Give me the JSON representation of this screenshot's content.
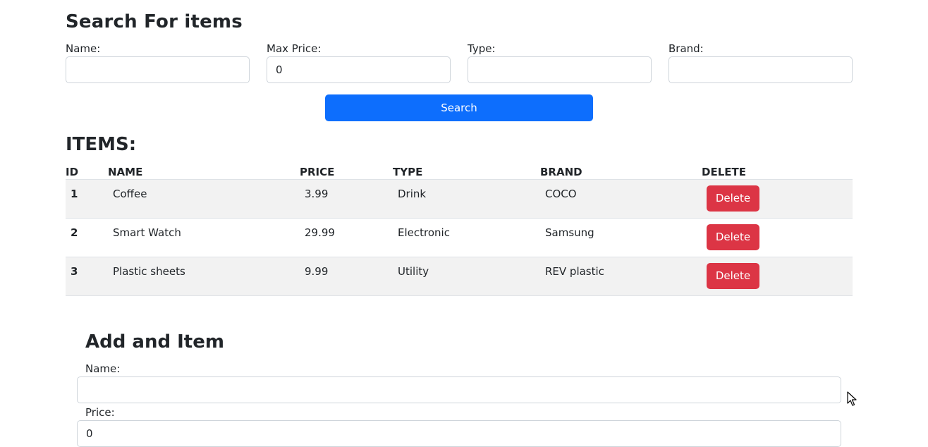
{
  "search": {
    "title": "Search For items",
    "fields": [
      {
        "label": "Name:",
        "value": "",
        "placeholder": ""
      },
      {
        "label": "Max Price:",
        "value": "0",
        "placeholder": ""
      },
      {
        "label": "Type:",
        "value": "",
        "placeholder": ""
      },
      {
        "label": "Brand:",
        "value": "",
        "placeholder": ""
      }
    ],
    "button_label": "Search"
  },
  "items": {
    "title": "ITEMS:",
    "columns": [
      "ID",
      "NAME",
      "PRICE",
      "TYPE",
      "BRAND",
      "DELETE"
    ],
    "rows": [
      {
        "id": "1",
        "name": "Coffee",
        "price": "3.99",
        "type": "Drink",
        "brand": "COCO",
        "action": "Delete"
      },
      {
        "id": "2",
        "name": "Smart Watch",
        "price": "29.99",
        "type": "Electronic",
        "brand": "Samsung",
        "action": "Delete"
      },
      {
        "id": "3",
        "name": "Plastic sheets",
        "price": "9.99",
        "type": "Utility",
        "brand": "REV plastic",
        "action": "Delete"
      }
    ]
  },
  "add_item": {
    "title": "Add and Item",
    "fields": [
      {
        "label": "Name:",
        "value": ""
      },
      {
        "label": "Price:",
        "value": "0"
      }
    ]
  },
  "colors": {
    "primary": "#0d6efd",
    "danger": "#dc3545",
    "striped_row": "#f2f2f2",
    "border": "#ced4da"
  },
  "icons": {
    "cursor": "mouse-pointer-icon"
  }
}
